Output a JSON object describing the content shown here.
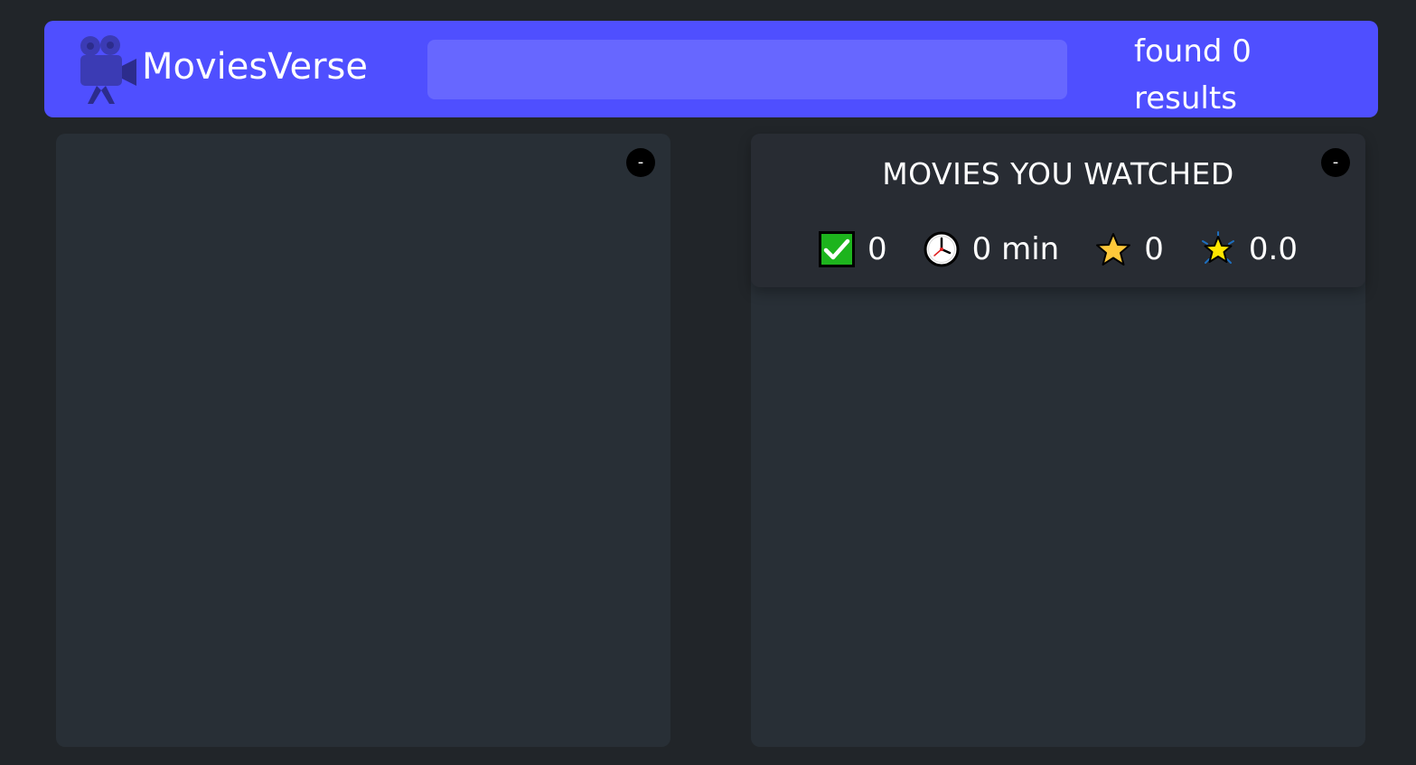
{
  "header": {
    "logo_icon": "movie-camera-icon",
    "app_name": "MoviesVerse",
    "search": {
      "value": "",
      "placeholder": ""
    },
    "num_results": "found 0 results",
    "accent_color": "#4f4fff"
  },
  "left_box": {
    "toggle_label": "-"
  },
  "right_box": {
    "toggle_label": "-",
    "summary": {
      "title": "MOVIES YOU WATCHED",
      "stats": [
        {
          "icon": "check-mark-icon",
          "value": "0"
        },
        {
          "icon": "clock-icon",
          "value": "0 min"
        },
        {
          "icon": "star-icon",
          "value": "0"
        },
        {
          "icon": "glowing-star-icon",
          "value": "0.0"
        }
      ]
    }
  }
}
